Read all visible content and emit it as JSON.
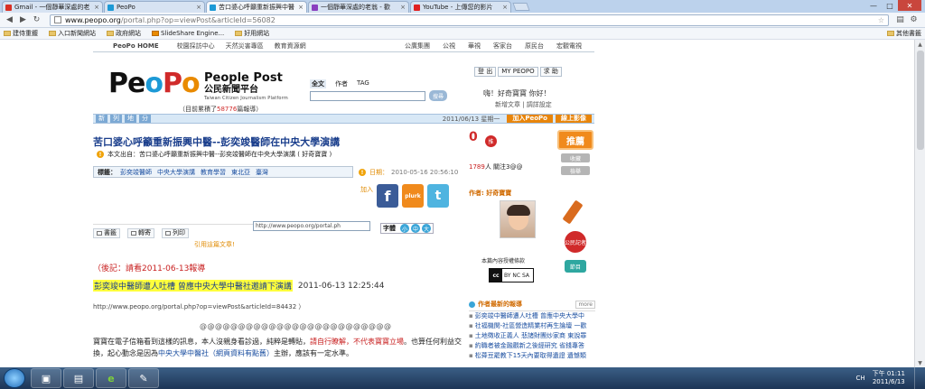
{
  "browser": {
    "tabs": [
      {
        "label": "Gmail - 一個靜華深處的老",
        "icon_color": "#d93025",
        "active": false
      },
      {
        "label": "PeoPo",
        "icon_color": "#1d9ad6",
        "active": false
      },
      {
        "label": "苦口婆心呼籲重新振興中醫",
        "icon_color": "#1d9ad6",
        "active": true
      },
      {
        "label": "一個靜華深處的老翁 - 歡",
        "icon_color": "#8a3fbf",
        "active": false
      },
      {
        "label": "YouTube - 上傳您的影片",
        "icon_color": "#e02020",
        "active": false
      }
    ],
    "url_host": "www.peopo.org",
    "url_path": "/portal.php?op=viewPost&articleId=56082",
    "bookmarks": [
      "建侍重鍍",
      "入口新聞網站",
      "政府網站",
      "SlideShare Engine...",
      "好用網站"
    ],
    "other_bookmarks": "其他書籤",
    "window_buttons": {
      "minimize": "—",
      "maximize": "□",
      "close": "✕"
    }
  },
  "site": {
    "home": "PeoPo HOME",
    "nav_left": [
      "校園採訪中心",
      "天然災害專區",
      "教育資源網"
    ],
    "nav_right": [
      "公廣集團",
      "公視",
      "華視",
      "客家台",
      "原民台",
      "宏觀電視"
    ],
    "logo": {
      "p": "Pe",
      "o1": "o",
      "p2": "P",
      "o2": "o"
    },
    "brand_en": "People Post",
    "brand_zh": "公民新聞平台",
    "brand_tag": "Taiwan Citizen Journalism Platform",
    "stat_prefix": "（目前累積了",
    "stat_num": "58776",
    "stat_suffix": "篇報導）",
    "search_tabs": [
      "全文",
      "作者",
      "TAG"
    ],
    "search_button": "搜尋",
    "account": [
      "登 出",
      "MY PEOPO",
      "求 助"
    ],
    "greeting": "嗨！好奇寶寶 你好！",
    "links": "新增文章 | 調詳設定",
    "sections": [
      "新",
      "列",
      "地",
      "分"
    ],
    "date": "2011/06/13 星期一",
    "join_btn": "加入PeoPo",
    "upload_btn": "線上影像"
  },
  "article": {
    "title": "苦口婆心呼籲重新振興中醫--彭奕竣醫師在中央大學演講",
    "warn_icon": "!",
    "source": "本文出自：苦口婆心呼籲重新振興中醫--彭奕竣醫師在中央大學演講 ( 好奇寶寶 )",
    "tags_label": "標籤：",
    "tags": [
      "彭奕竣醫師",
      "中央大學演講",
      "教育學習",
      "東北亞",
      "臺灣"
    ],
    "date_label": "日期：",
    "date": "2010-05-16 20:56:10",
    "add_label": "加入",
    "social": {
      "facebook": "f",
      "plurk": "plurk",
      "twitter": "t"
    },
    "actions": [
      "書籤",
      "轉寄",
      "列印"
    ],
    "cite": "引用這篇文章!",
    "cite_url": "http://www.peopo.org/portal.ph",
    "font_label": "字體",
    "font_sizes": [
      "小",
      "中",
      "大"
    ],
    "note": "（後記：請看2011-06-13報導",
    "highlight": "彭奕竣中醫師遭人吐槽 曾應中央大學中醫社邀請下演講",
    "highlight_time": "2011-06-13 12:25:44",
    "src_url": "http://www.peopo.org/portal.php?op=viewPost&articleId=84432 ）",
    "separator": "@@@@@@@@@@@@@@@@@@@@@@@@@",
    "body_a": "寶寶在電子信箱看到這樣的訊息，本人沒親身看診過，純粹是轉貼，",
    "body_red": "請自行瞭解，不代表寶寶立場",
    "body_b": "。也算任何利益交換，起心動念是因為",
    "body_blue": "中央大學中醫社（網頁資料有點舊）",
    "body_c": "主辦，應該有一定水準。"
  },
  "sidebar": {
    "votes": "0",
    "vote_label": "推",
    "recommend": "推薦",
    "small_btns": [
      "收藏",
      "檢舉"
    ],
    "views_count": "1789",
    "views_text": "人 關注3@@",
    "author_label": "作者: 好奇寶寶",
    "license": "本篇內容授權條款",
    "cc": {
      "left": "cc",
      "right": "BY NC SA"
    },
    "citizen_journalist": "公民記者",
    "cc_button": "節目",
    "latest_title": "作者最新的報導",
    "latest_more": "more",
    "latest": [
      "彭奕竣中醫師遭人吐槽 曾應中央大學中",
      "社福機関-社區營造精業村再生論壇 一歡",
      "土地徵收正義人 悲諸財團炒家商 東說罪",
      "約職者被金融觀新之後經研究 省錢專答",
      "松蕣豆罷教下15天內要取得遺證 遺憾類"
    ]
  },
  "taskbar": {
    "ime": "CH",
    "time": "下午 01:11",
    "date": "2011/6/13",
    "apps": [
      "▣",
      "▤",
      "e",
      "✎"
    ]
  }
}
